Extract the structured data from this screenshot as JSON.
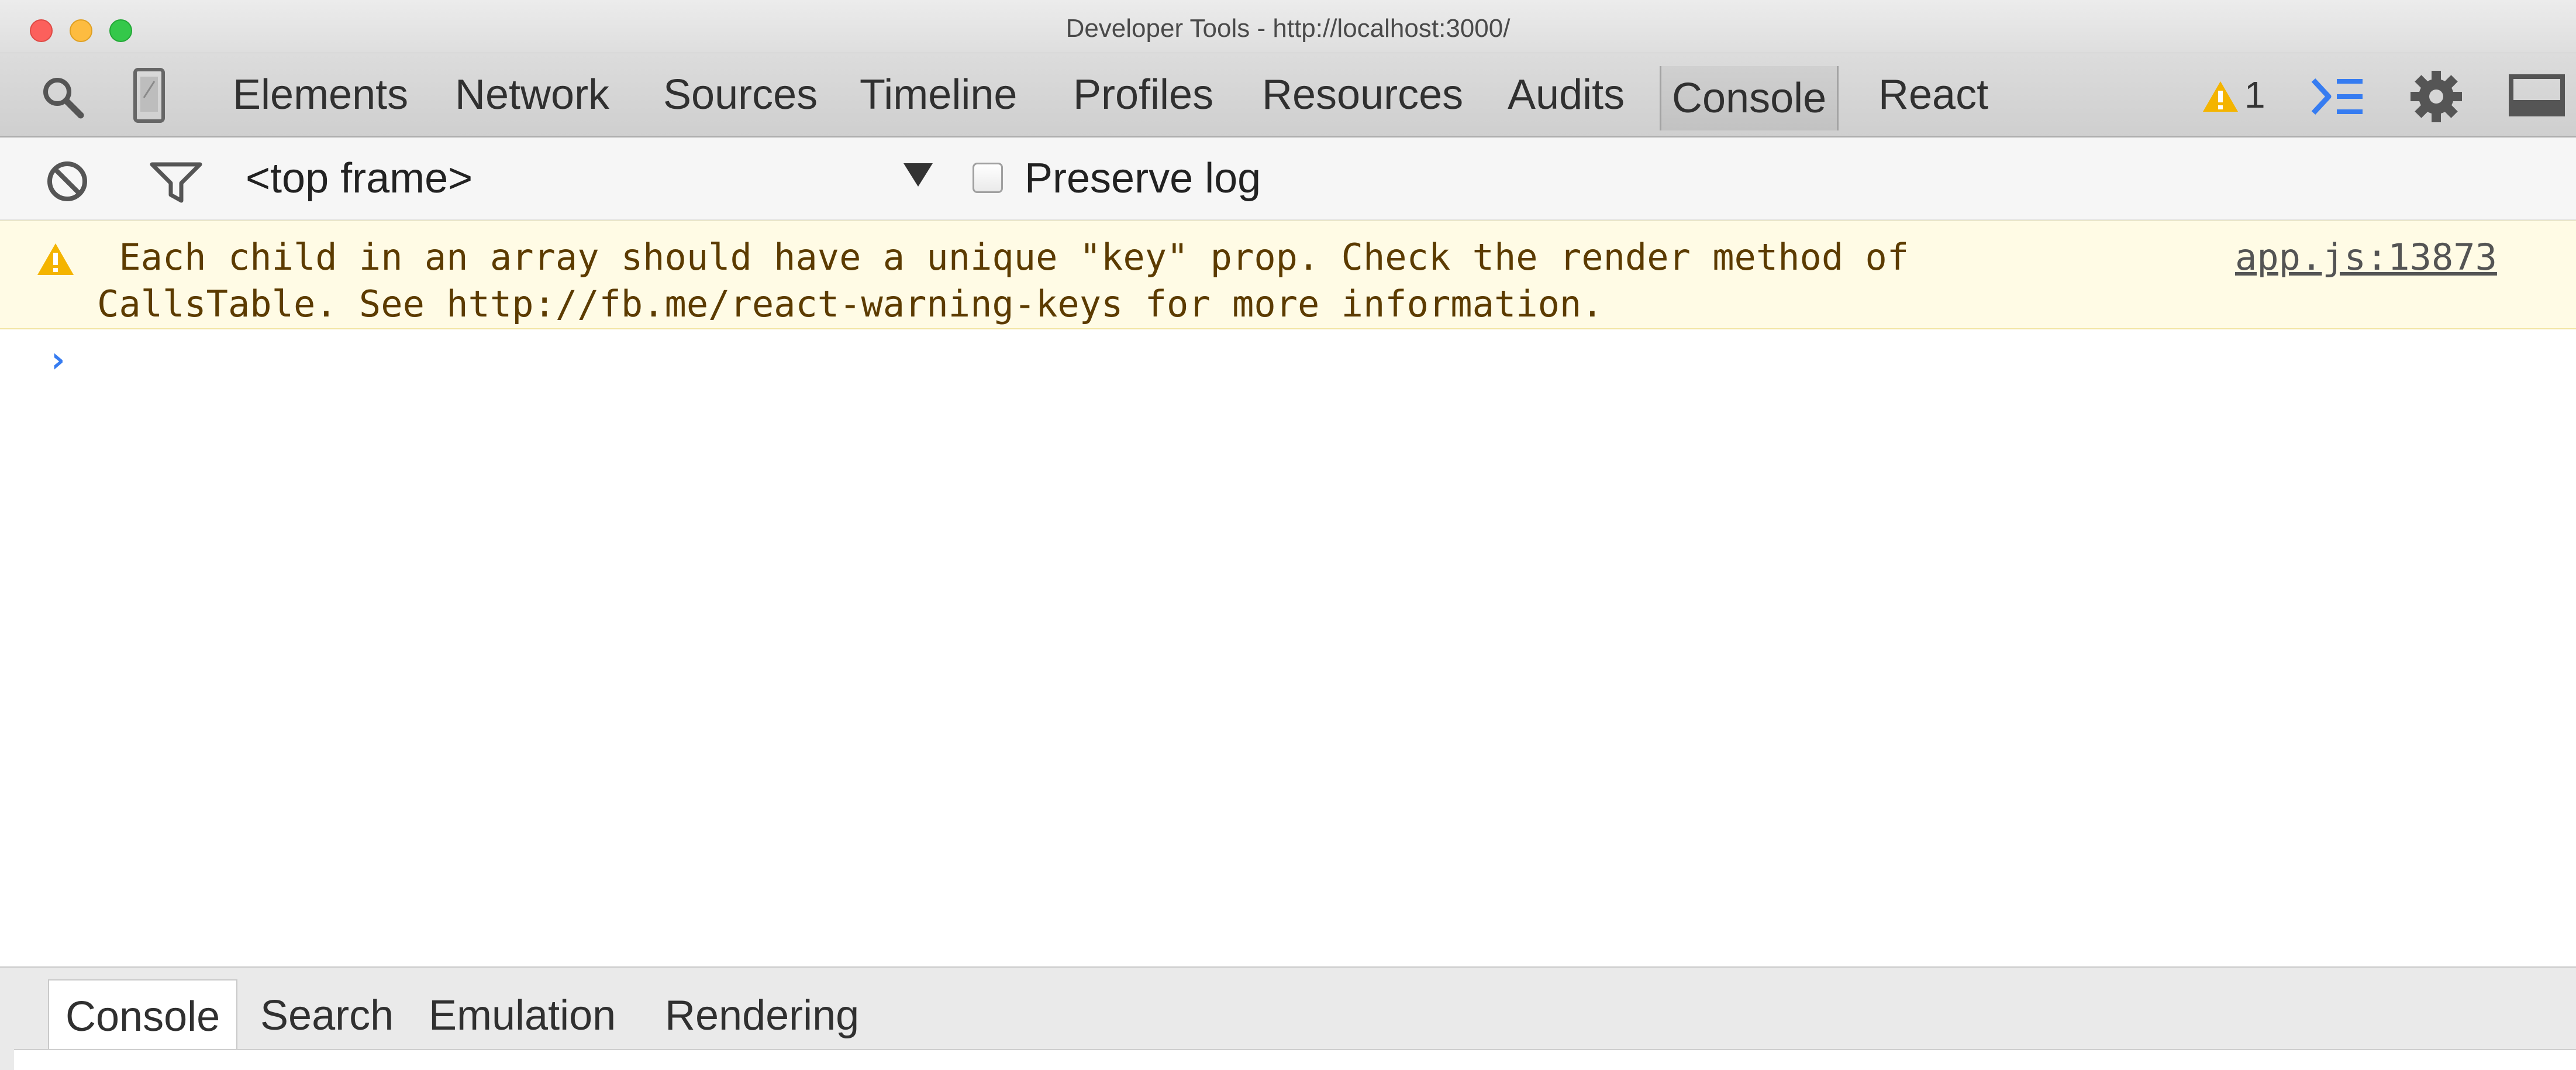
{
  "window": {
    "title": "Developer Tools - http://localhost:3000/"
  },
  "toolbar": {
    "tabs": [
      {
        "id": "elements",
        "label": "Elements"
      },
      {
        "id": "network",
        "label": "Network"
      },
      {
        "id": "sources",
        "label": "Sources"
      },
      {
        "id": "timeline",
        "label": "Timeline"
      },
      {
        "id": "profiles",
        "label": "Profiles"
      },
      {
        "id": "resources",
        "label": "Resources"
      },
      {
        "id": "audits",
        "label": "Audits"
      },
      {
        "id": "console",
        "label": "Console"
      },
      {
        "id": "react",
        "label": "React"
      }
    ],
    "active_tab": "console",
    "warning_count": "1",
    "icons": [
      "search-icon",
      "device-mode-icon",
      "warning-icon",
      "drawer-toggle-icon",
      "gear-icon",
      "dock-icon"
    ],
    "colors": {
      "warning": "#f4b400",
      "accent_blue": "#367cf1"
    }
  },
  "console_toolbar": {
    "frame_selector": "<top frame>",
    "preserve_log_label": "Preserve log",
    "preserve_log_checked": false,
    "icons": [
      "clear-console-icon",
      "filter-icon"
    ]
  },
  "messages": [
    {
      "level": "warning",
      "line1": " Each child in an array should have a unique \"key\" prop. Check the render method of",
      "line2": "CallsTable. See http://fb.me/react-warning-keys for more information.",
      "source": "app.js:13873"
    }
  ],
  "prompt_symbol": "›",
  "drawer": {
    "tabs": [
      {
        "id": "console",
        "label": "Console"
      },
      {
        "id": "search",
        "label": "Search"
      },
      {
        "id": "emulation",
        "label": "Emulation"
      },
      {
        "id": "rendering",
        "label": "Rendering"
      }
    ],
    "active_tab": "console"
  }
}
